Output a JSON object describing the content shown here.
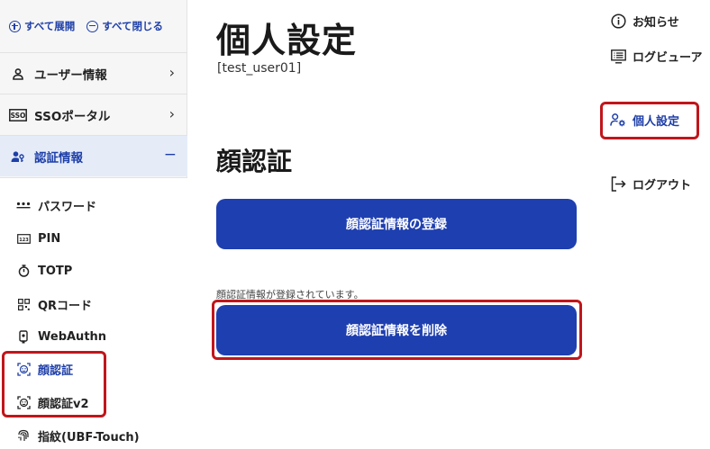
{
  "sidebar": {
    "expand_all": "すべて展開",
    "collapse_all": "すべて閉じる",
    "sections": [
      {
        "label": "ユーザー情報"
      },
      {
        "label": "SSOポータル"
      },
      {
        "label": "認証情報"
      }
    ],
    "auth_items": [
      {
        "label": "パスワード"
      },
      {
        "label": "PIN"
      },
      {
        "label": "TOTP"
      },
      {
        "label": "QRコード"
      },
      {
        "label": "WebAuthn"
      },
      {
        "label": "顔認証"
      },
      {
        "label": "顔認証v2"
      },
      {
        "label": "指紋(UBF-Touch)"
      }
    ]
  },
  "main": {
    "title": "個人設定",
    "user": "[test_user01]",
    "section_title": "顔認証",
    "register_button": "顔認証情報の登録",
    "status": "顔認証情報が登録されています。",
    "delete_button": "顔認証情報を削除"
  },
  "header_menu": {
    "notifications": "お知らせ",
    "log_viewer": "ログビューア",
    "personal_settings": "個人設定",
    "logout": "ログアウト"
  },
  "colors": {
    "accent": "#1e3fb0",
    "highlight": "#c0161b"
  }
}
